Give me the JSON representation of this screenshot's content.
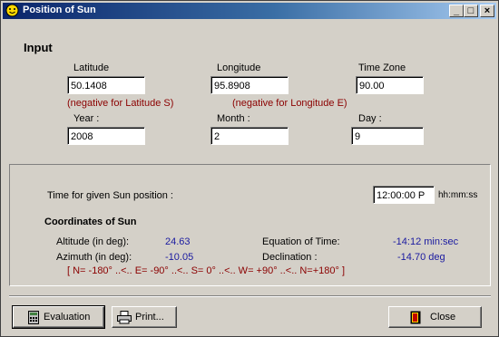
{
  "window": {
    "title": "Position of Sun"
  },
  "titlebar_buttons": {
    "minimize": "_",
    "maximize": "□",
    "close": "×"
  },
  "input": {
    "heading": "Input",
    "latitude": {
      "label": "Latitude",
      "value": "50.1408",
      "note": "(negative for Latitude S)"
    },
    "longitude": {
      "label": "Longitude",
      "value": "95.8908",
      "note": "(negative for Longitude E)"
    },
    "timezone": {
      "label": "Time Zone",
      "value": "90.00"
    },
    "year": {
      "label": "Year :",
      "value": "2008"
    },
    "month": {
      "label": "Month :",
      "value": "2"
    },
    "day": {
      "label": "Day :",
      "value": "9"
    }
  },
  "time": {
    "label": "Time for given Sun position :",
    "value": "12:00:00 P",
    "unit": "hh:mm:ss"
  },
  "coords": {
    "heading": "Coordinates of Sun",
    "altitude_label": "Altitude (in deg):",
    "altitude_value": "24.63",
    "azimuth_label": "Azimuth (in deg):",
    "azimuth_value": "-10.05",
    "eot_label": "Equation of Time:",
    "eot_value": "-14:12  min:sec",
    "declination_label": "Declination :",
    "declination_value": "-14.70 deg",
    "azimuth_legend": "[ N= -180° ..<..  E= -90° ..<..  S= 0° ..<..  W= +90° ..<..  N=+180° ]"
  },
  "buttons": {
    "evaluation": "Evaluation",
    "print": "Print...",
    "close": "Close"
  },
  "colors": {
    "title_start": "#0a246a",
    "title_end": "#a6caf0",
    "note_red": "#8b0000",
    "value_blue": "#1a1aa0",
    "face": "#d4d0c8"
  }
}
